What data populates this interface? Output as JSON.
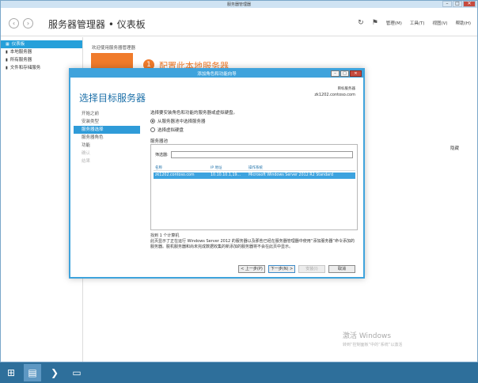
{
  "outer": {
    "title": "服务器管理器",
    "win_min": "–",
    "win_max": "□",
    "win_close": "✕",
    "nav_back": "‹",
    "nav_fwd": "›",
    "header_title": "服务器管理器 • 仪表板",
    "refresh_icon": "↻",
    "flag_icon": "⚑",
    "menus": [
      "管理(M)",
      "工具(T)",
      "视图(V)",
      "帮助(H)"
    ],
    "sidebar": [
      {
        "icon": "▦",
        "label": "仪表板",
        "active": true
      },
      {
        "icon": "▮",
        "label": "本地服务器",
        "active": false
      },
      {
        "icon": "▮",
        "label": "所有服务器",
        "active": false
      },
      {
        "icon": "▮",
        "label": "文件和存储服务",
        "active": false
      }
    ],
    "welcome": "欢迎使用服务器管理器",
    "configure_num": "1",
    "configure_text": "配置此本地服务器",
    "hide": "隐藏",
    "activate_title": "激活 Windows",
    "activate_sub": "转到“控制面板”中的“系统”以激活"
  },
  "wizard": {
    "title": "添加角色和功能向导",
    "heading": "选择目标服务器",
    "dest_label": "目标服务器",
    "dest_server": "zk1202.contoso.com",
    "steps": [
      {
        "label": "开始之前",
        "state": "normal"
      },
      {
        "label": "安装类型",
        "state": "normal"
      },
      {
        "label": "服务器选择",
        "state": "active"
      },
      {
        "label": "服务器角色",
        "state": "normal"
      },
      {
        "label": "功能",
        "state": "normal"
      },
      {
        "label": "确认",
        "state": "disabled"
      },
      {
        "label": "结果",
        "state": "disabled"
      }
    ],
    "description": "选择要安装角色和功能的服务器或虚拟硬盘。",
    "option_pool": "从服务器池中选择服务器",
    "option_vhd": "选择虚拟硬盘",
    "pool_label": "服务器池",
    "filter_label": "筛选器:",
    "columns": [
      "名称",
      "IP 地址",
      "操作系统"
    ],
    "rows": [
      {
        "name": "zk1202.contoso.com",
        "ip": "10.10.10.1,19...",
        "os": "Microsoft Windows Server 2012 R2 Standard"
      }
    ],
    "found": "找到 1 个计算机",
    "note": "此页显示了正在运行 Windows Server 2012 的服务器以及那些已经在服务器管理器中使用“添加服务器”命令添加的服务器。脱机服务器和尚未完成数据收集的新添加的服务器将不会在此页中显示。",
    "btn_prev": "< 上一步(P)",
    "btn_next": "下一步(N) >",
    "btn_install": "安装(I)",
    "btn_cancel": "取消"
  },
  "taskbar": {
    "start_icon": "⊞",
    "sm_icon": "▤",
    "ps_icon": "❯",
    "explorer_icon": "▭",
    "time": "",
    "date": ""
  }
}
